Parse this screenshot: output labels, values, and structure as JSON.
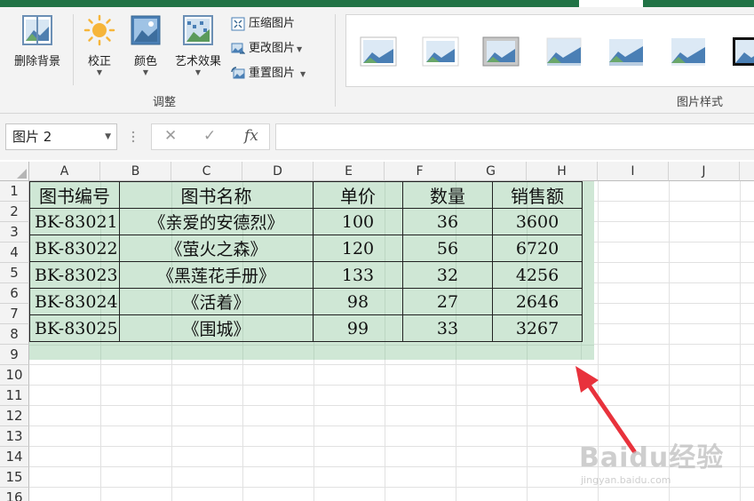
{
  "ribbon": {
    "buttons": {
      "remove_bg": "删除背景",
      "corrections": "校正",
      "color": "颜色",
      "artistic": "艺术效果",
      "compress": "压缩图片",
      "change": "更改图片",
      "reset": "重置图片"
    },
    "groups": {
      "adjust": "调整",
      "picture_styles": "图片样式"
    }
  },
  "formula_bar": {
    "name_box": "图片 2",
    "fx_label": "fx",
    "formula": ""
  },
  "sheet": {
    "columns": [
      "A",
      "B",
      "C",
      "D",
      "E",
      "F",
      "G",
      "H",
      "I",
      "J"
    ],
    "rows": [
      "1",
      "2",
      "3",
      "4",
      "5",
      "6",
      "7",
      "8",
      "9",
      "10",
      "11",
      "12",
      "13",
      "14",
      "15",
      "16"
    ]
  },
  "picture_table": {
    "headers": [
      "图书编号",
      "图书名称",
      "单价",
      "数量",
      "销售额"
    ],
    "rows": [
      [
        "BK-83021",
        "《亲爱的安德烈》",
        "100",
        "36",
        "3600"
      ],
      [
        "BK-83022",
        "《萤火之森》",
        "120",
        "56",
        "6720"
      ],
      [
        "BK-83023",
        "《黑莲花手册》",
        "133",
        "32",
        "4256"
      ],
      [
        "BK-83024",
        "《活着》",
        "98",
        "27",
        "2646"
      ],
      [
        "BK-83025",
        "《围城》",
        "99",
        "33",
        "3267"
      ]
    ]
  },
  "watermark": {
    "main": "Baidu经验",
    "sub": "jingyan.baidu.com"
  },
  "colors": {
    "excel_green": "#217346",
    "picture_fill": "#cfe7d5",
    "arrow_red": "#e8323c"
  }
}
